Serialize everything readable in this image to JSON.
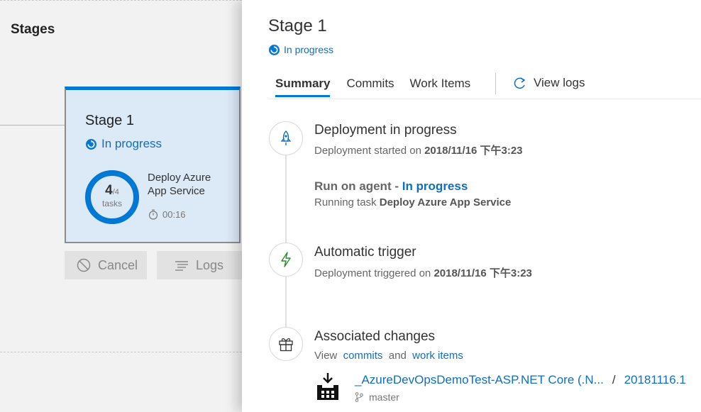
{
  "pipeline": {
    "title": "Stages",
    "stage": {
      "name": "Stage 1",
      "status": "In progress",
      "tasks_done": "4",
      "tasks_total": "/4",
      "tasks_label": "tasks",
      "task_name": "Deploy Azure App Service",
      "elapsed": "00:16",
      "progress_fraction": 1.0
    },
    "buttons": {
      "cancel": "Cancel",
      "logs": "Logs"
    }
  },
  "panel": {
    "title": "Stage 1",
    "status": "In progress",
    "tabs": [
      {
        "label": "Summary",
        "active": true
      },
      {
        "label": "Commits",
        "active": false
      },
      {
        "label": "Work Items",
        "active": false
      }
    ],
    "view_logs": "View logs",
    "timeline": {
      "deployment": {
        "heading": "Deployment in progress",
        "sub_prefix": "Deployment started on ",
        "sub_date": "2018/11/16 下午3:23"
      },
      "agent": {
        "heading_prefix": "Run on agent - ",
        "heading_status": "In progress",
        "sub_prefix": "Running task ",
        "sub_task": "Deploy Azure App Service"
      },
      "trigger": {
        "heading": "Automatic trigger",
        "sub_prefix": "Deployment triggered on ",
        "sub_date": "2018/11/16 下午3:23"
      },
      "changes": {
        "heading": "Associated changes",
        "view": "View",
        "commits_link": "commits",
        "and": "and",
        "work_items_link": "work items"
      }
    },
    "artifact": {
      "name": "_AzureDevOpsDemoTest-ASP.NET Core (.N...",
      "separator": "/",
      "version": "20181116.1",
      "branch": "master"
    }
  },
  "colors": {
    "accent": "#0078d4",
    "link": "#106ebe",
    "card_bg": "#dce9f7",
    "trigger_green": "#2a8a2a"
  }
}
